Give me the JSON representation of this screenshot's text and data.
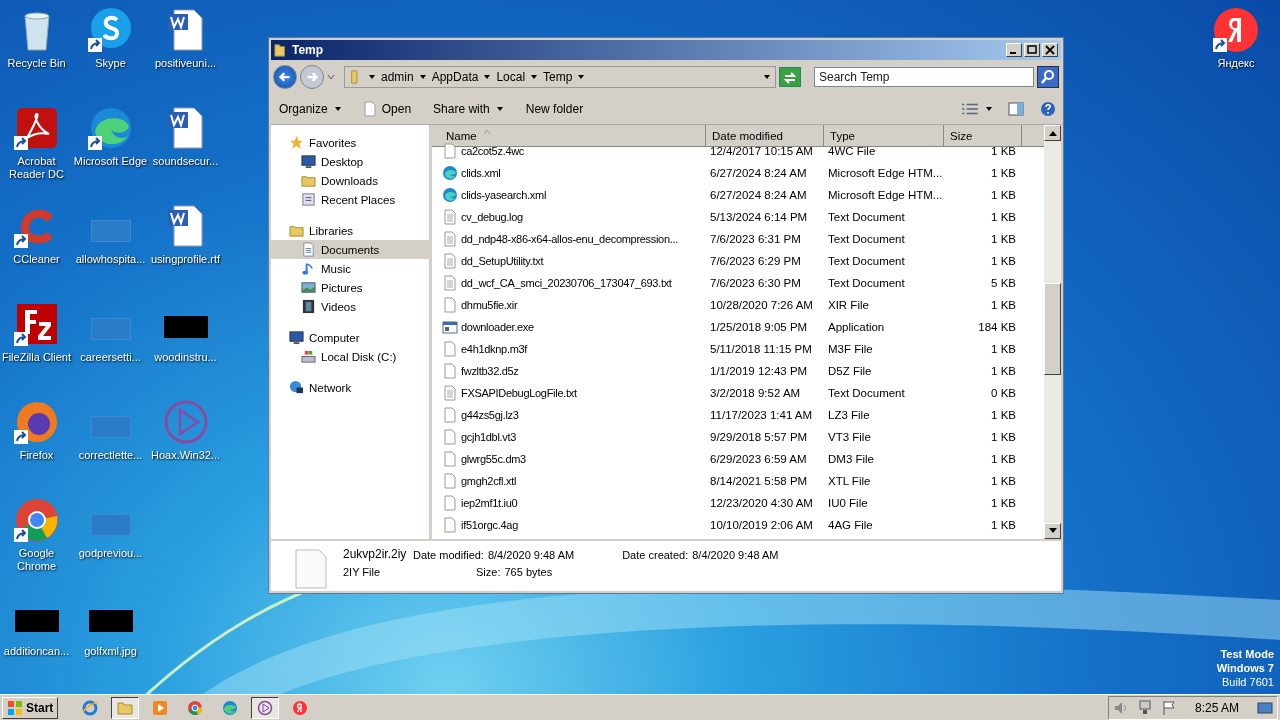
{
  "desktop": {
    "icons": [
      {
        "label": "Recycle Bin",
        "kind": "recycle",
        "shortcut": false
      },
      {
        "label": "Acrobat Reader DC",
        "kind": "acrobat",
        "shortcut": true
      },
      {
        "label": "CCleaner",
        "kind": "ccleaner",
        "shortcut": true
      },
      {
        "label": "FileZilla Client",
        "kind": "filezilla",
        "shortcut": true
      },
      {
        "label": "Firefox",
        "kind": "firefox",
        "shortcut": true
      },
      {
        "label": "Google Chrome",
        "kind": "chrome",
        "shortcut": true
      },
      {
        "label": "additioncan...",
        "kind": "black",
        "shortcut": false
      },
      {
        "label": "Skype",
        "kind": "skype",
        "shortcut": true
      },
      {
        "label": "Microsoft Edge",
        "kind": "edge",
        "shortcut": true
      },
      {
        "label": "allowhospita...",
        "kind": "blank",
        "shortcut": false
      },
      {
        "label": "careersetti...",
        "kind": "blank",
        "shortcut": false
      },
      {
        "label": "correctlette...",
        "kind": "blank",
        "shortcut": false
      },
      {
        "label": "godpreviou...",
        "kind": "blank",
        "shortcut": false
      },
      {
        "label": "golfxml.jpg",
        "kind": "black",
        "shortcut": false
      },
      {
        "label": "positiveuni...",
        "kind": "word",
        "shortcut": false
      },
      {
        "label": "soundsecur...",
        "kind": "word",
        "shortcut": false
      },
      {
        "label": "usingprofile.rtf",
        "kind": "word",
        "shortcut": false
      },
      {
        "label": "woodinstru...",
        "kind": "black",
        "shortcut": false
      },
      {
        "label": "Hoax.Win32...",
        "kind": "hoax",
        "shortcut": false
      }
    ],
    "corner_icon": {
      "label": "Яндекс",
      "kind": "yandex",
      "shortcut": true
    },
    "watermark_text": [
      "Test Mode",
      "Windows 7",
      "Build 7601"
    ]
  },
  "window": {
    "title": "Temp",
    "breadcrumb": [
      "admin",
      "AppData",
      "Local",
      "Temp"
    ],
    "search": {
      "placeholder": "Search Temp"
    },
    "toolbar": [
      {
        "label": "Organize",
        "kind": "menu"
      },
      {
        "label": "Open",
        "kind": "open"
      },
      {
        "label": "Share with",
        "kind": "menu"
      },
      {
        "label": "New folder",
        "kind": "plain"
      }
    ],
    "nav": [
      {
        "label": "Favorites",
        "kind": "star",
        "selected": false,
        "children": [
          {
            "label": "Desktop",
            "kind": "desktop",
            "selected": false
          },
          {
            "label": "Downloads",
            "kind": "downloads",
            "selected": false
          },
          {
            "label": "Recent Places",
            "kind": "recent",
            "selected": false
          }
        ]
      },
      {
        "label": "Libraries",
        "kind": "libraries",
        "selected": false,
        "children": [
          {
            "label": "Documents",
            "kind": "documents",
            "selected": true
          },
          {
            "label": "Music",
            "kind": "music",
            "selected": false
          },
          {
            "label": "Pictures",
            "kind": "pictures",
            "selected": false
          },
          {
            "label": "Videos",
            "kind": "videos",
            "selected": false
          }
        ]
      },
      {
        "label": "Computer",
        "kind": "computer",
        "selected": false,
        "children": [
          {
            "label": "Local Disk (C:)",
            "kind": "disk",
            "selected": false
          }
        ]
      },
      {
        "label": "Network",
        "kind": "network",
        "selected": false
      }
    ],
    "columns": [
      {
        "label": "Name",
        "sorted": true
      },
      {
        "label": "Date modified",
        "sorted": false
      },
      {
        "label": "Type",
        "sorted": false
      },
      {
        "label": "Size",
        "sorted": false
      }
    ],
    "rows": [
      {
        "name": "ca2cot5z.4wc",
        "date": "12/4/2017 10:15 AM",
        "type": "4WC File",
        "size": "1 KB",
        "kind": "blank"
      },
      {
        "name": "clids.xml",
        "date": "6/27/2024 8:24 AM",
        "type": "Microsoft Edge HTM...",
        "size": "1 KB",
        "kind": "edge"
      },
      {
        "name": "clids-yasearch.xml",
        "date": "6/27/2024 8:24 AM",
        "type": "Microsoft Edge HTM...",
        "size": "1 KB",
        "kind": "edge"
      },
      {
        "name": "cv_debug.log",
        "date": "5/13/2024 6:14 PM",
        "type": "Text Document",
        "size": "1 KB",
        "kind": "text"
      },
      {
        "name": "dd_ndp48-x86-x64-allos-enu_decompression...",
        "date": "7/6/2023 6:31 PM",
        "type": "Text Document",
        "size": "1 KB",
        "kind": "text"
      },
      {
        "name": "dd_SetupUtility.txt",
        "date": "7/6/2023 6:29 PM",
        "type": "Text Document",
        "size": "1 KB",
        "kind": "text"
      },
      {
        "name": "dd_wcf_CA_smci_20230706_173047_693.txt",
        "date": "7/6/2023 6:30 PM",
        "type": "Text Document",
        "size": "5 KB",
        "kind": "text"
      },
      {
        "name": "dhmu5fie.xir",
        "date": "10/28/2020 7:26 AM",
        "type": "XIR File",
        "size": "1 KB",
        "kind": "blank"
      },
      {
        "name": "downloader.exe",
        "date": "1/25/2018 9:05 PM",
        "type": "Application",
        "size": "184 KB",
        "kind": "exe"
      },
      {
        "name": "e4h1dknp.m3f",
        "date": "5/11/2018 11:15 PM",
        "type": "M3F File",
        "size": "1 KB",
        "kind": "blank"
      },
      {
        "name": "fwzltb32.d5z",
        "date": "1/1/2019 12:43 PM",
        "type": "D5Z File",
        "size": "1 KB",
        "kind": "blank"
      },
      {
        "name": "FXSAPIDebugLogFile.txt",
        "date": "3/2/2018 9:52 AM",
        "type": "Text Document",
        "size": "0 KB",
        "kind": "text"
      },
      {
        "name": "g44zs5gj.lz3",
        "date": "11/17/2023 1:41 AM",
        "type": "LZ3 File",
        "size": "1 KB",
        "kind": "blank"
      },
      {
        "name": "gcjh1dbl.vt3",
        "date": "9/29/2018 5:57 PM",
        "type": "VT3 File",
        "size": "1 KB",
        "kind": "blank"
      },
      {
        "name": "glwrg55c.dm3",
        "date": "6/29/2023 6:59 AM",
        "type": "DM3 File",
        "size": "1 KB",
        "kind": "blank"
      },
      {
        "name": "gmgh2cfl.xtl",
        "date": "8/14/2021 5:58 PM",
        "type": "XTL File",
        "size": "1 KB",
        "kind": "blank"
      },
      {
        "name": "iep2mf1t.iu0",
        "date": "12/23/2020 4:30 AM",
        "type": "IU0 File",
        "size": "1 KB",
        "kind": "blank"
      },
      {
        "name": "if51orgc.4ag",
        "date": "10/10/2019 2:06 AM",
        "type": "4AG File",
        "size": "1 KB",
        "kind": "blank"
      }
    ],
    "details": {
      "name": "2ukvp2ir.2iy",
      "type": "2IY File",
      "fields": [
        {
          "label": "Date modified:",
          "value": "8/4/2020 9:48 AM"
        },
        {
          "label": "Size:",
          "value": "765 bytes"
        },
        {
          "label": "Date created:",
          "value": "8/4/2020 9:48 AM"
        }
      ]
    }
  },
  "taskbar": {
    "start": "Start",
    "apps": [
      {
        "kind": "ie",
        "selected": false
      },
      {
        "kind": "explorer",
        "selected": true
      },
      {
        "kind": "media",
        "selected": false
      },
      {
        "kind": "chrome",
        "selected": false
      },
      {
        "kind": "edge",
        "selected": false
      },
      {
        "kind": "hoax",
        "selected": true
      },
      {
        "kind": "yandex",
        "selected": false
      }
    ],
    "clock": "8:25 AM"
  }
}
